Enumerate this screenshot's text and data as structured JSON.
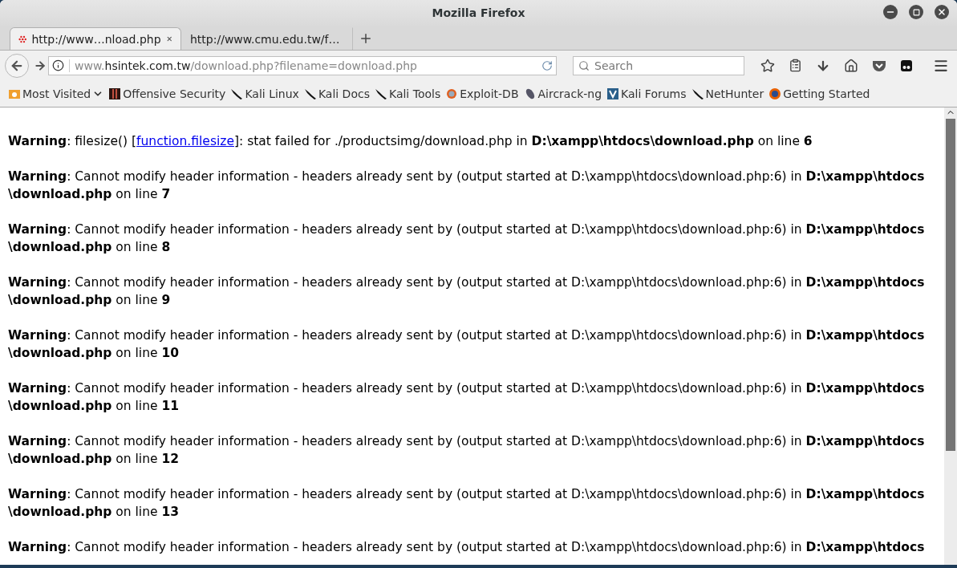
{
  "window": {
    "title": "Mozilla Firefox"
  },
  "tabs": [
    {
      "label": "http://www…nload.php",
      "selected": true
    },
    {
      "label": "http://www.cmu.edu.tw/f…",
      "selected": false
    }
  ],
  "address_bar": {
    "host_prefix": "www.",
    "host": "hsintek.com.tw",
    "path": "/download.php?filename=download.php"
  },
  "search": {
    "placeholder": "Search"
  },
  "bookmarks": [
    {
      "label": "Most Visited",
      "kind": "folder"
    },
    {
      "label": "Offensive Security",
      "kind": "offsec"
    },
    {
      "label": "Kali Linux",
      "kind": "kali"
    },
    {
      "label": "Kali Docs",
      "kind": "kali"
    },
    {
      "label": "Kali Tools",
      "kind": "kali"
    },
    {
      "label": "Exploit-DB",
      "kind": "exploit"
    },
    {
      "label": "Aircrack-ng",
      "kind": "aircrack"
    },
    {
      "label": "Kali Forums",
      "kind": "forums"
    },
    {
      "label": "NetHunter",
      "kind": "kali"
    },
    {
      "label": "Getting Started",
      "kind": "firefox"
    }
  ],
  "warnings": [
    {
      "segments": [
        {
          "text": "**Warning**: filesize() ["
        },
        {
          "link": "function.filesize"
        },
        {
          "text": "]: stat failed for ./productsimg/download.php in **D:\\xampp\\htdocs\\download.php** on line **6**"
        }
      ]
    },
    {
      "segments": [
        {
          "text": "**Warning**: Cannot modify header information - headers already sent by (output started at D:\\xampp\\htdocs\\download.php:6) in **D:\\xampp\\htdocs\\download.php** on line **7**"
        }
      ]
    },
    {
      "segments": [
        {
          "text": "**Warning**: Cannot modify header information - headers already sent by (output started at D:\\xampp\\htdocs\\download.php:6) in **D:\\xampp\\htdocs\\download.php** on line **8**"
        }
      ]
    },
    {
      "segments": [
        {
          "text": "**Warning**: Cannot modify header information - headers already sent by (output started at D:\\xampp\\htdocs\\download.php:6) in **D:\\xampp\\htdocs\\download.php** on line **9**"
        }
      ]
    },
    {
      "segments": [
        {
          "text": "**Warning**: Cannot modify header information - headers already sent by (output started at D:\\xampp\\htdocs\\download.php:6) in **D:\\xampp\\htdocs\\download.php** on line **10**"
        }
      ]
    },
    {
      "segments": [
        {
          "text": "**Warning**: Cannot modify header information - headers already sent by (output started at D:\\xampp\\htdocs\\download.php:6) in **D:\\xampp\\htdocs\\download.php** on line **11**"
        }
      ]
    },
    {
      "segments": [
        {
          "text": "**Warning**: Cannot modify header information - headers already sent by (output started at D:\\xampp\\htdocs\\download.php:6) in **D:\\xampp\\htdocs\\download.php** on line **12**"
        }
      ]
    },
    {
      "segments": [
        {
          "text": "**Warning**: Cannot modify header information - headers already sent by (output started at D:\\xampp\\htdocs\\download.php:6) in **D:\\xampp\\htdocs\\download.php** on line **13**"
        }
      ]
    },
    {
      "segments": [
        {
          "text": "**Warning**: Cannot modify header information - headers already sent by (output started at D:\\xampp\\htdocs\\download.php:6) in **D:\\xampp\\htdocs**"
        }
      ]
    }
  ]
}
